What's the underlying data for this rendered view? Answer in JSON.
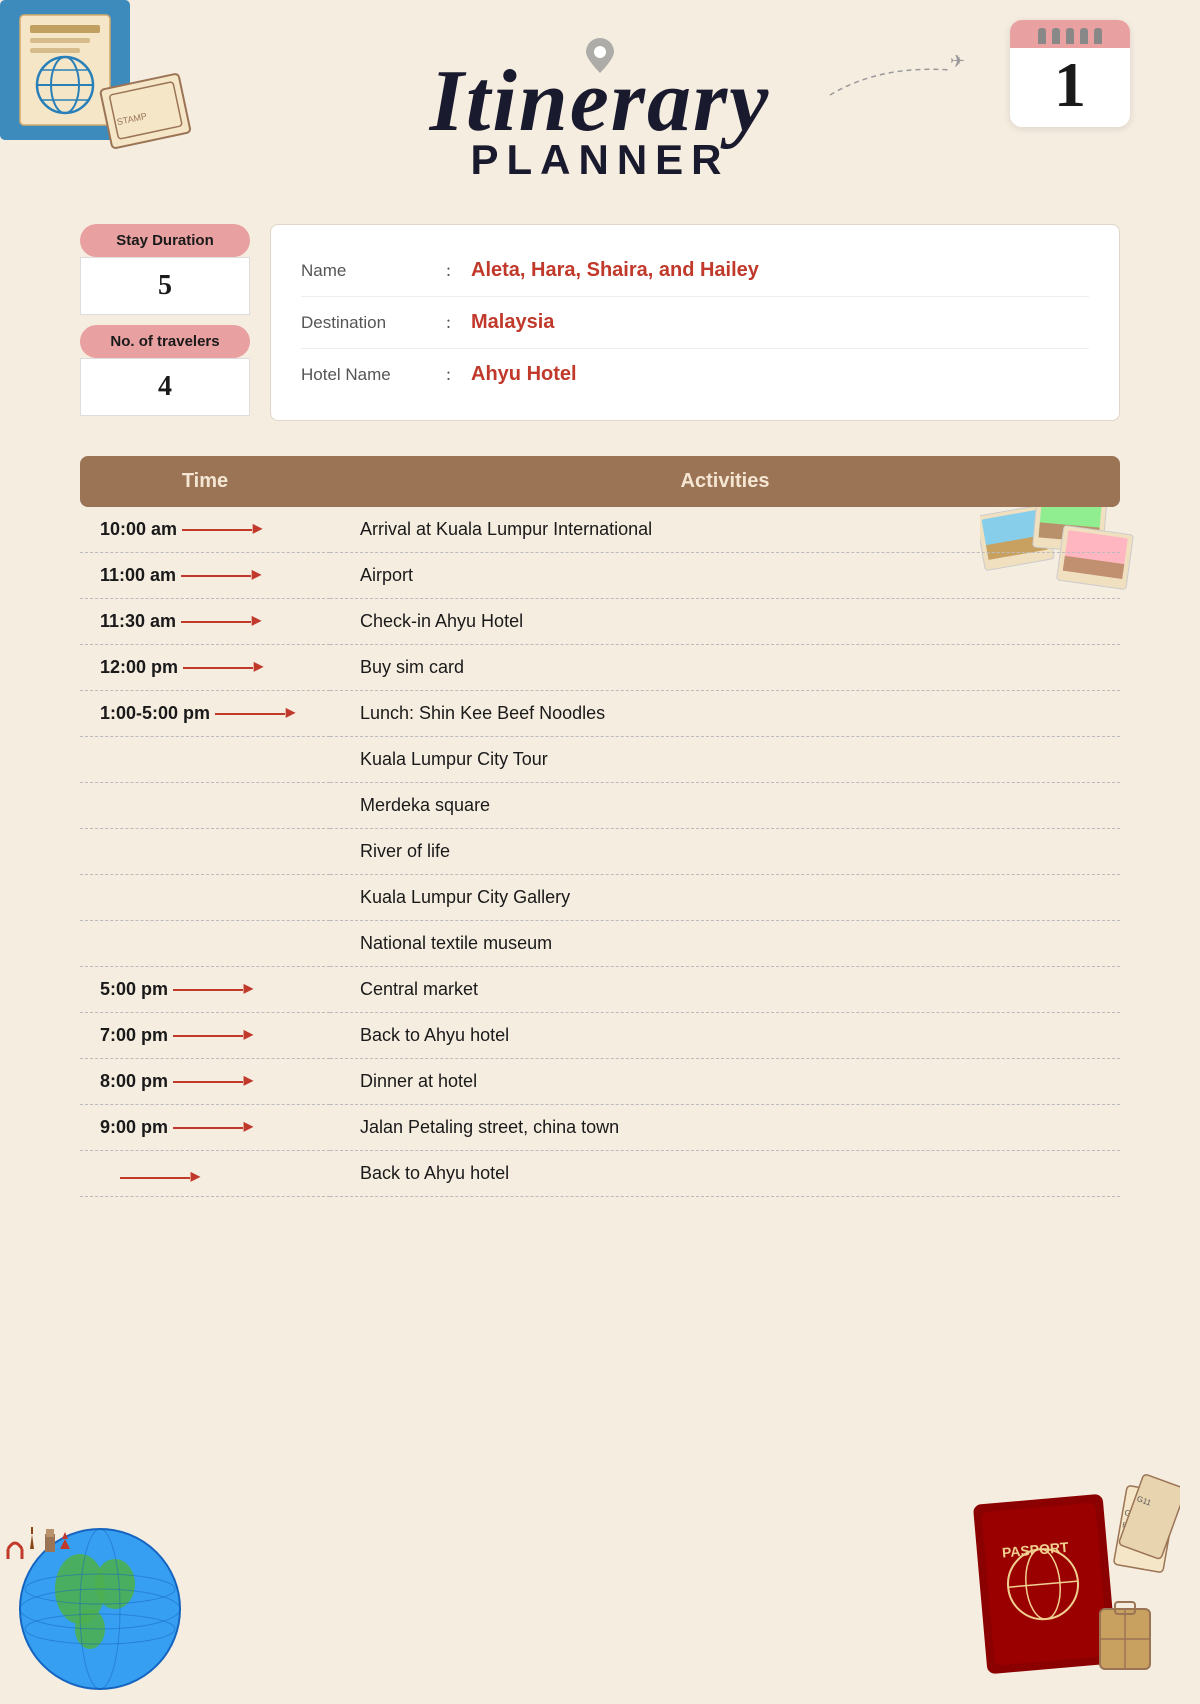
{
  "header": {
    "title_itinerary": "Itinerary",
    "title_planner": "PLANNER",
    "day_number": "1"
  },
  "info": {
    "stay_duration_label": "Stay Duration",
    "stay_duration_value": "5",
    "travelers_label": "No. of travelers",
    "travelers_value": "4",
    "name_label": "Name",
    "name_colon": ":",
    "name_value": "Aleta, Hara, Shaira, and Hailey",
    "destination_label": "Destination",
    "destination_colon": ":",
    "destination_value": "Malaysia",
    "hotel_label": "Hotel Name",
    "hotel_colon": ":",
    "hotel_value": "Ahyu Hotel"
  },
  "table": {
    "header_time": "Time",
    "header_activities": "Activities",
    "rows": [
      {
        "time": "10:00 am",
        "activity": "Arrival at Kuala Lumpur International",
        "has_arrow": true
      },
      {
        "time": "11:00 am",
        "activity": "Airport",
        "has_arrow": true
      },
      {
        "time": "11:30 am",
        "activity": "Check-in Ahyu Hotel",
        "has_arrow": true
      },
      {
        "time": "12:00 pm",
        "activity": "Buy sim card",
        "has_arrow": true
      },
      {
        "time": "1:00-5:00 pm",
        "activity": "Lunch: Shin Kee Beef Noodles",
        "has_arrow": true
      },
      {
        "time": "",
        "activity": "Kuala Lumpur City Tour",
        "has_arrow": false
      },
      {
        "time": "",
        "activity": "Merdeka square",
        "has_arrow": false
      },
      {
        "time": "",
        "activity": "River of life",
        "has_arrow": false
      },
      {
        "time": "",
        "activity": "Kuala Lumpur City Gallery",
        "has_arrow": false
      },
      {
        "time": "",
        "activity": "National textile museum",
        "has_arrow": false
      },
      {
        "time": "5:00 pm",
        "activity": "Central market",
        "has_arrow": true
      },
      {
        "time": "7:00 pm",
        "activity": "Back to Ahyu hotel",
        "has_arrow": true
      },
      {
        "time": "8:00 pm",
        "activity": "Dinner at hotel",
        "has_arrow": true
      },
      {
        "time": "9:00 pm",
        "activity": "Jalan Petaling street, china town",
        "has_arrow": true
      },
      {
        "time": "",
        "activity": "Back to Ahyu hotel",
        "has_arrow": true
      }
    ]
  }
}
